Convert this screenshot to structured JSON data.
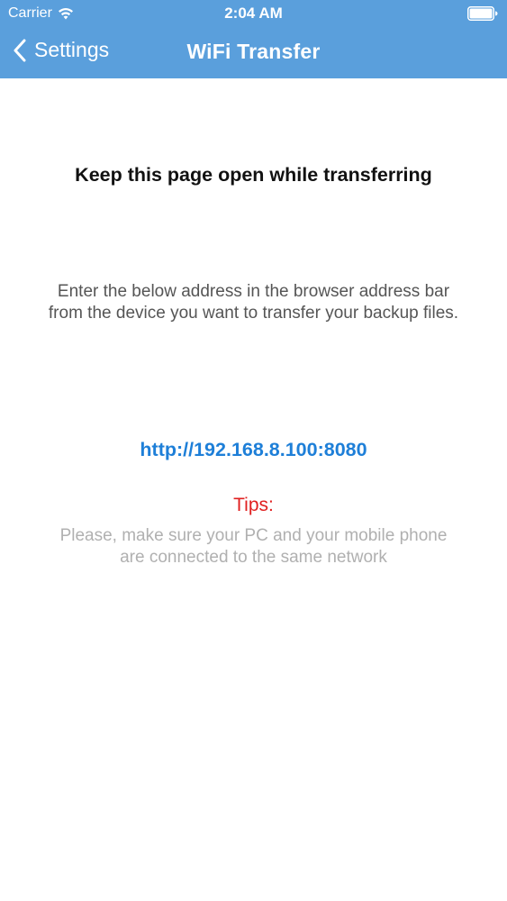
{
  "status_bar": {
    "carrier": "Carrier",
    "time": "2:04 AM",
    "wifi_icon": "wifi-icon",
    "battery_icon": "battery-icon"
  },
  "nav_bar": {
    "back_label": "Settings",
    "back_icon": "chevron-left-icon",
    "title": "WiFi Transfer",
    "color": "#5a9fdc"
  },
  "content": {
    "heading": "Keep this page open while transferring",
    "instructions": "Enter the below address in the browser address bar from the device you want to transfer your backup files.",
    "address": "http://192.168.8.100:8080",
    "address_color": "#1e7fd8",
    "tips_label": "Tips:",
    "tips_color": "#e02020",
    "tips_text": "Please, make sure your PC and your mobile phone are connected to the same network"
  }
}
